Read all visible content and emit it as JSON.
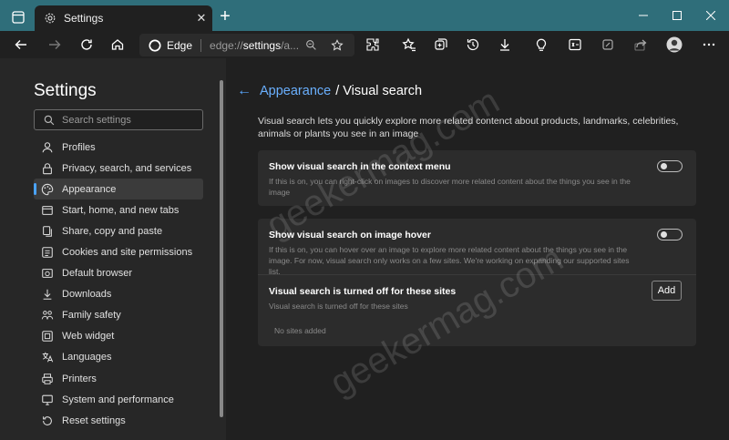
{
  "tab": {
    "title": "Settings",
    "close": "✕"
  },
  "window": {
    "new_tab": "+"
  },
  "address": {
    "brand": "Edge",
    "url_scheme": "edge://",
    "url_host": "settings",
    "url_rest": "/a..."
  },
  "sidebar": {
    "title": "Settings",
    "search_placeholder": "Search settings",
    "items": [
      {
        "label": "Profiles",
        "icon": "person-icon"
      },
      {
        "label": "Privacy, search, and services",
        "icon": "lock-icon"
      },
      {
        "label": "Appearance",
        "icon": "appearance-icon"
      },
      {
        "label": "Start, home, and new tabs",
        "icon": "home-tabs-icon"
      },
      {
        "label": "Share, copy and paste",
        "icon": "share-icon"
      },
      {
        "label": "Cookies and site permissions",
        "icon": "cookies-icon"
      },
      {
        "label": "Default browser",
        "icon": "browser-icon"
      },
      {
        "label": "Downloads",
        "icon": "download-icon"
      },
      {
        "label": "Family safety",
        "icon": "family-icon"
      },
      {
        "label": "Web widget",
        "icon": "widget-icon"
      },
      {
        "label": "Languages",
        "icon": "language-icon"
      },
      {
        "label": "Printers",
        "icon": "printer-icon"
      },
      {
        "label": "System and performance",
        "icon": "system-icon"
      },
      {
        "label": "Reset settings",
        "icon": "reset-icon"
      }
    ]
  },
  "main": {
    "breadcrumb_link": "Appearance",
    "breadcrumb_current": "/ Visual search",
    "description": "Visual search lets you quickly explore more related contenct about products, landmarks, celebrities, animals or plants you see in an image",
    "context_menu": {
      "title": "Show visual search in the context menu",
      "desc": "If this is on, you can right-click on images to discover more related content about the things you see in the image"
    },
    "hover": {
      "title": "Show visual search on image hover",
      "desc": "If this is on, you can hover over an image to explore more related content about the things you see in the image. For now, visual search only works on a few sites. We're working on expanding our supported sites list."
    },
    "sites": {
      "title": "Visual search is turned off for these sites",
      "desc": "Visual search is turned off for these sites",
      "add": "Add",
      "empty": "No sites added"
    }
  },
  "watermark": "geekermag.com",
  "colors": {
    "accent": "#4aa3ff",
    "titlebar": "#2f6e7a",
    "background": "#202020"
  }
}
